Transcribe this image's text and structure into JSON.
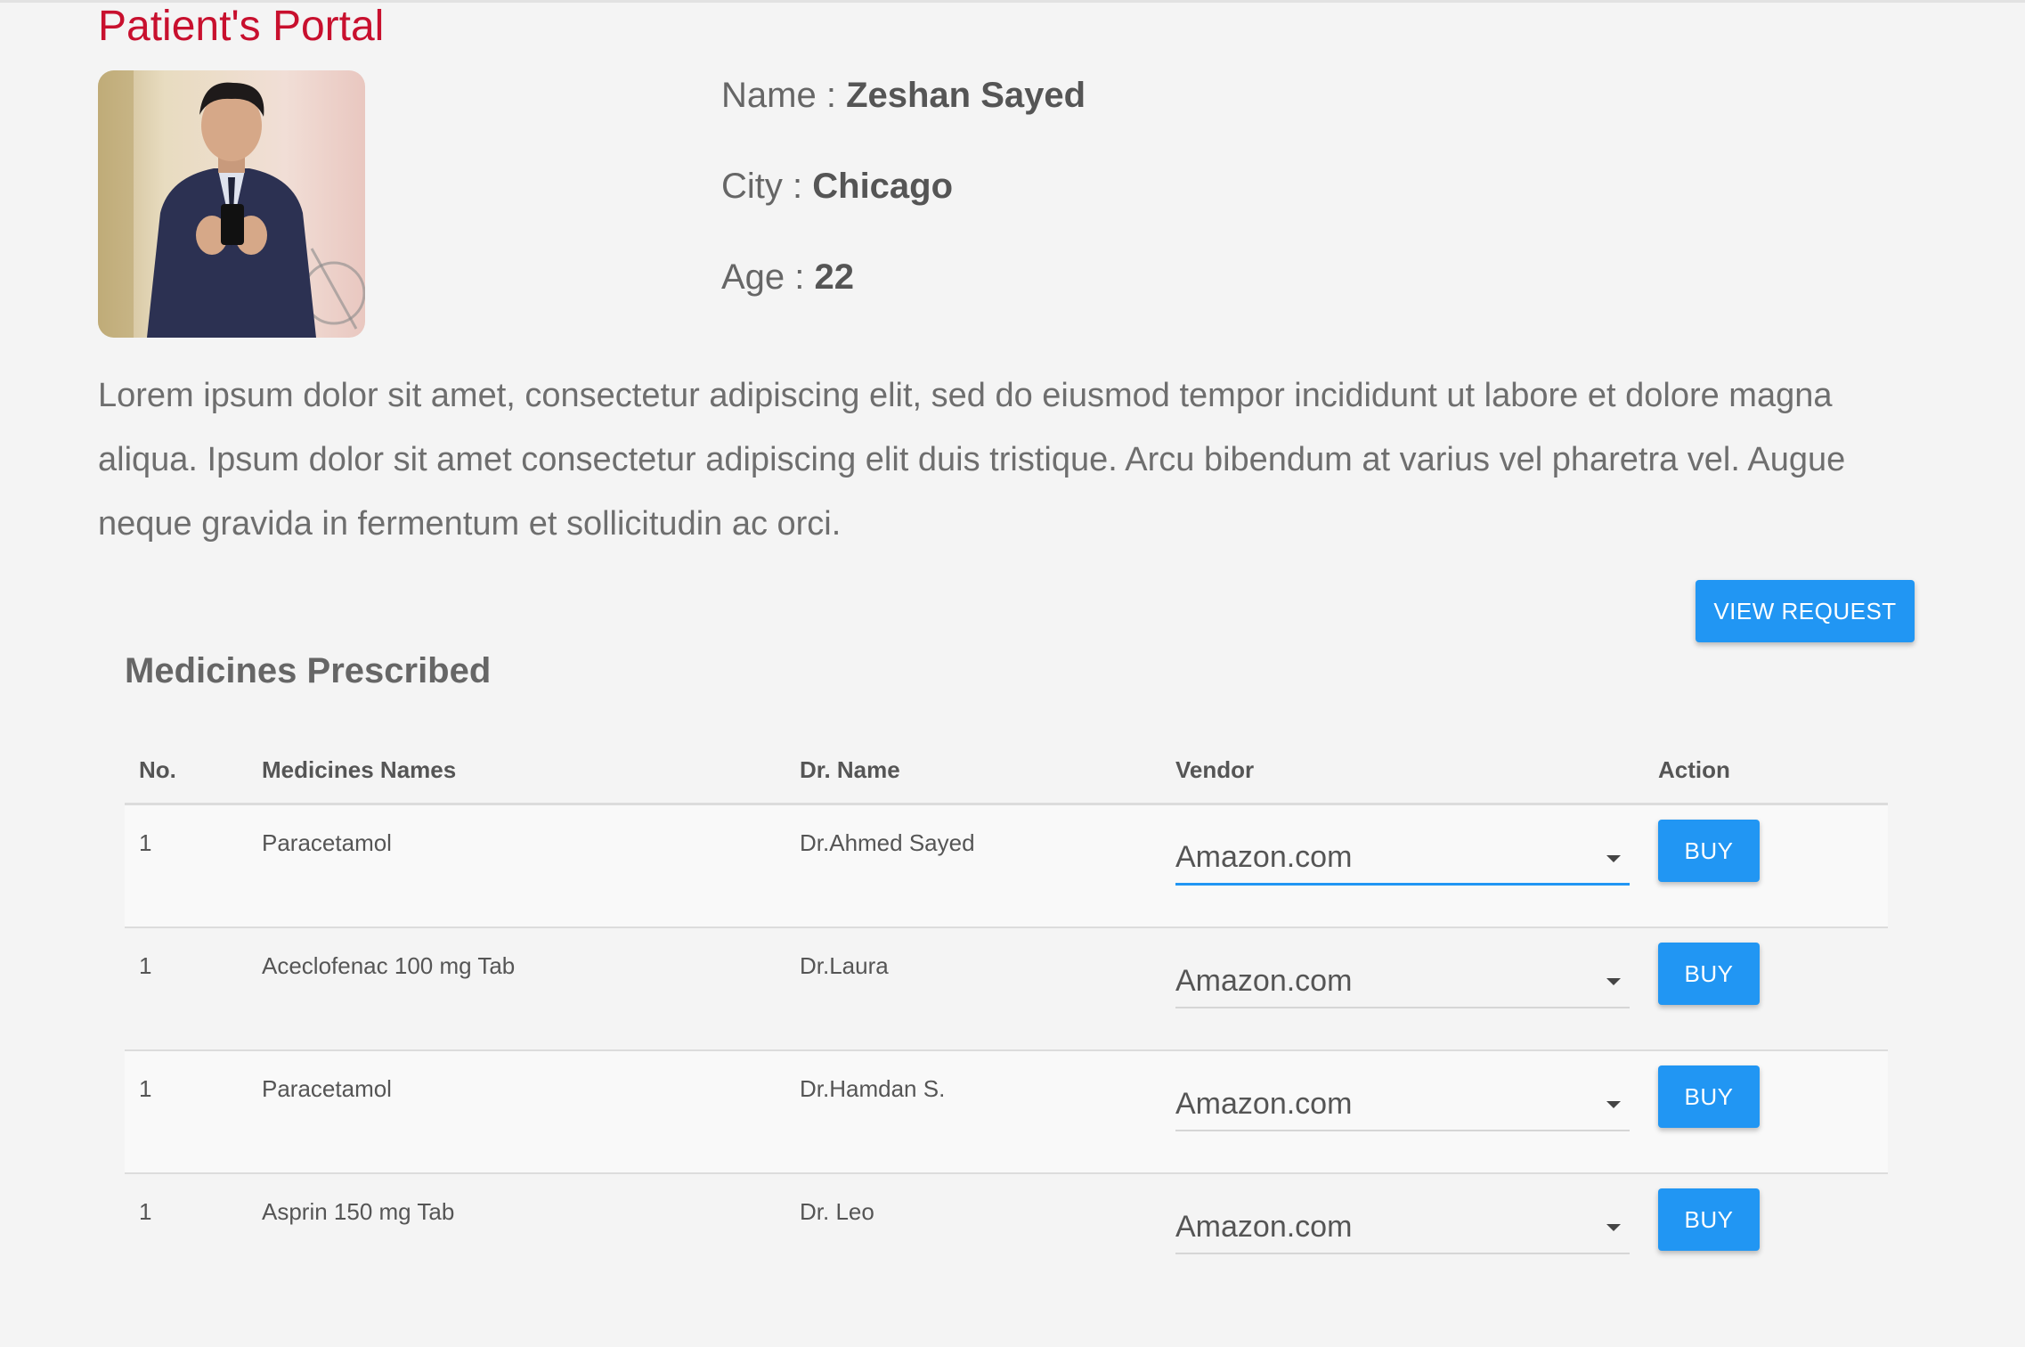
{
  "header": {
    "title": "Patient's Portal"
  },
  "patient": {
    "name_label": "Name :",
    "name_value": "Zeshan Sayed",
    "city_label": "City :",
    "city_value": "Chicago",
    "age_label": "Age :",
    "age_value": "22",
    "bio": "Lorem ipsum dolor sit amet, consectetur adipiscing elit, sed do eiusmod tempor incididunt ut labore et dolore magna aliqua. Ipsum dolor sit amet consectetur adipiscing elit duis tristique. Arcu bibendum at varius vel pharetra vel. Augue neque gravida in fermentum et sollicitudin ac orci."
  },
  "actions": {
    "view_request_label": "VIEW REQUEST"
  },
  "medicines": {
    "title": "Medicines Prescribed",
    "columns": {
      "no": "No.",
      "name": "Medicines Names",
      "doctor": "Dr. Name",
      "vendor": "Vendor",
      "action": "Action"
    },
    "rows": [
      {
        "no": "1",
        "name": "Paracetamol",
        "doctor": "Dr.Ahmed Sayed",
        "vendor": "Amazon.com",
        "action": "BUY"
      },
      {
        "no": "1",
        "name": "Aceclofenac 100 mg Tab",
        "doctor": "Dr.Laura",
        "vendor": "Amazon.com",
        "action": "BUY"
      },
      {
        "no": "1",
        "name": "Paracetamol",
        "doctor": "Dr.Hamdan S.",
        "vendor": "Amazon.com",
        "action": "BUY"
      },
      {
        "no": "1",
        "name": "Asprin 150 mg Tab",
        "doctor": "Dr. Leo",
        "vendor": "Amazon.com",
        "action": "BUY"
      }
    ]
  },
  "colors": {
    "title_red": "#c8102e",
    "button_blue": "#2196f3",
    "background": "#f4f4f4"
  }
}
